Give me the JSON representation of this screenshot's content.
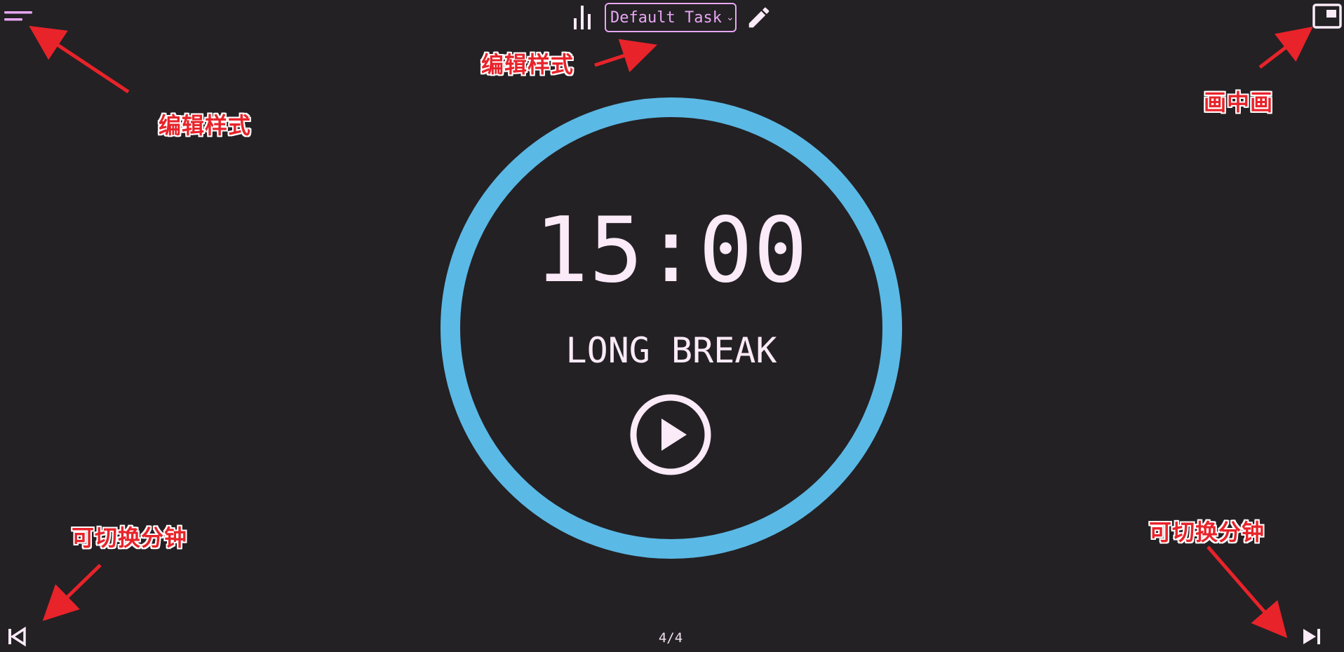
{
  "header": {
    "task_select_value": "Default Task",
    "chevron": "⌄"
  },
  "icons": {
    "menu": "menu-icon",
    "stats": "bar-chart-icon",
    "edit": "pencil-icon",
    "pip": "picture-in-picture-icon",
    "play": "play-icon",
    "prev": "skip-previous-icon",
    "next": "skip-next-icon"
  },
  "timer": {
    "time": "15:00",
    "phase": "LONG BREAK",
    "progress": 1.0
  },
  "footer": {
    "counter": "4/4"
  },
  "annotations": {
    "menu_note": "编辑样式",
    "task_note": "编辑样式",
    "pip_note": "画中画",
    "prev_note": "可切换分钟",
    "next_note": "可切换分钟"
  },
  "colors": {
    "background": "#232124",
    "ring": "#5bb9e6",
    "accent": "#e8a6f3",
    "text": "#fbeaf8",
    "annotation": "#e8232a"
  }
}
